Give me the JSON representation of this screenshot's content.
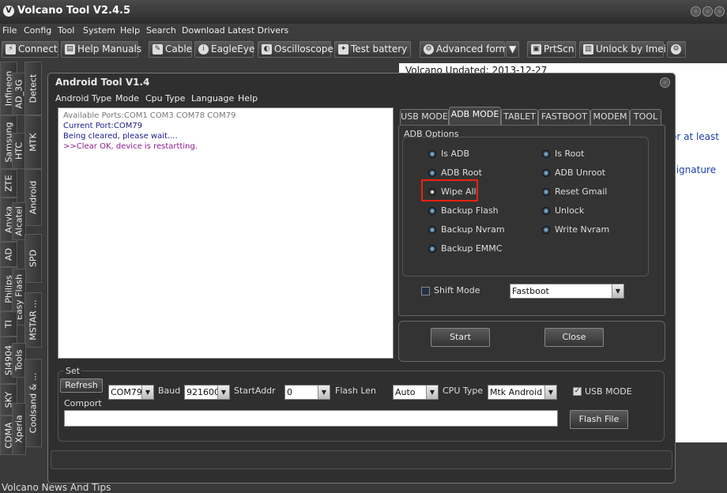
{
  "app": {
    "title": "Volcano Tool V2.4.5",
    "logo_glyph": "V"
  },
  "menu": [
    "File",
    "Config",
    "Tool",
    "System",
    "Help",
    "Search",
    "Download Latest Drivers"
  ],
  "toolbar": {
    "connect": "Connect",
    "help_manuals": "Help Manuals",
    "cable": "Cable",
    "eagleeye": "EagleEye",
    "oscilloscope": "Oscilloscope",
    "test_battery": "Test battery",
    "advanced_form": "Advanced form",
    "prtscn": "PrtScn",
    "unlock_imei": "Unlock by Imei"
  },
  "vtabs": {
    "infineon": "Infineon",
    "ad_3g": "AD_3G",
    "detect": "Detect",
    "samsung": "Samsung",
    "htc": "HTC",
    "mtk": "MTK",
    "zte": "ZTE",
    "android": "Android",
    "anyka": "Anyka",
    "alcatel": "Alcatel",
    "ad": "AD",
    "spd": "SPD",
    "philips": "Philips",
    "easy_flash": "Easy Flash",
    "mstar": "MSTAR ...",
    "ti": "TI",
    "si4904": "SI4904",
    "tools": "Tools",
    "sky": "SKY",
    "coolsand": "Coolsand & ...",
    "cdma": "CDMA",
    "xperia": "Xperia"
  },
  "news": {
    "updated": "Volcano Updated: 2013-12-27",
    "line_a": "for at least",
    "line_b": "Signature",
    "footer": "Volcano News And Tips"
  },
  "dialog": {
    "title": "Android Tool V1.4",
    "menu": [
      "Android Type",
      "Mode",
      "Cpu Type",
      "Language",
      "Help"
    ],
    "log": [
      "Available Ports:COM1 COM3 COM78 COM79",
      "Current Port:COM79",
      "Being cleared, please wait....",
      ">>Clear OK, device is restartting."
    ],
    "tabs": [
      "USB MODE",
      "ADB MODE",
      "TABLET",
      "FASTBOOT",
      "MODEM",
      "TOOL"
    ],
    "active_tab": "ADB MODE",
    "adb_options_label": "ADB Options",
    "options_left": [
      "Is ADB",
      "ADB Root",
      "Wipe All",
      "Backup Flash",
      "Backup Nvram",
      "Backup EMMC"
    ],
    "options_right": [
      "Is Root",
      "ADB Unroot",
      "Reset Gmail",
      "Unlock",
      "Write Nvram"
    ],
    "selected_option": "Wipe All",
    "highlight_color": "#e21a1a",
    "shift_mode_label": "Shift Mode",
    "shift_mode_checked": false,
    "shift_mode_value": "Fastboot",
    "start": "Start",
    "close": "Close",
    "set": {
      "label": "Set",
      "refresh": "Refresh",
      "com": "COM79",
      "baud_label": "Baud",
      "baud": "921600",
      "startaddr_label": "StartAddr",
      "startaddr": "0",
      "flashlen_label": "Flash Len",
      "flashlen": "Auto",
      "cputype_label": "CPU Type",
      "cputype": "Mtk Android",
      "usb_mode_label": "USB MODE",
      "usb_mode_checked": true,
      "comport_label": "Comport",
      "comport_value": "",
      "flash_file": "Flash File"
    }
  }
}
